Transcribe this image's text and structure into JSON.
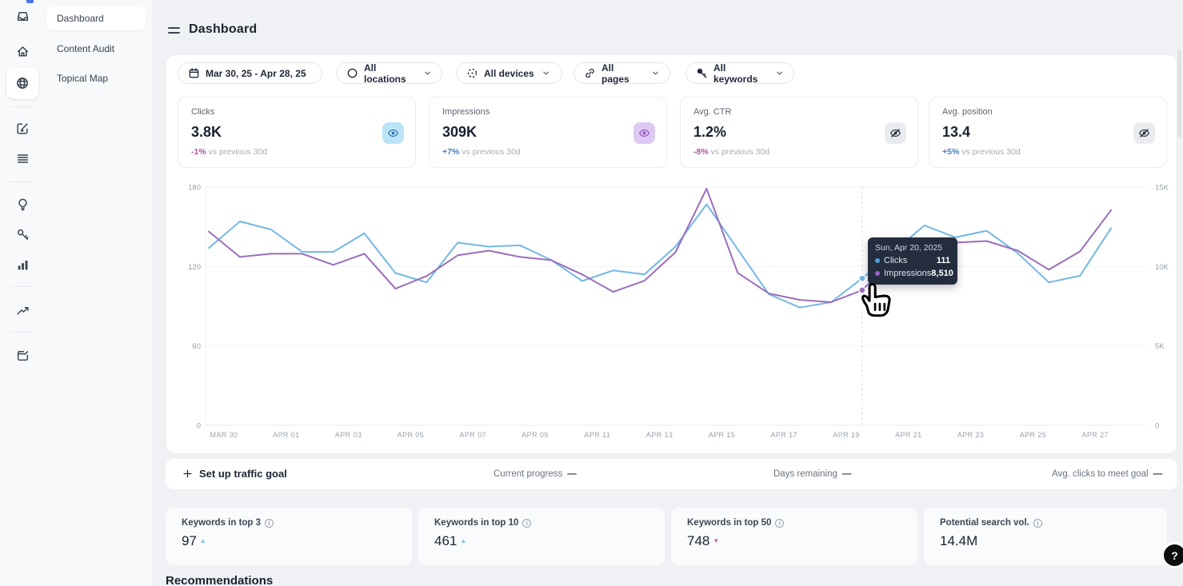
{
  "sidebar": {
    "icons": [
      "inbox-icon",
      "home-icon",
      "globe-icon",
      "compose-icon",
      "list-icon",
      "bulb-icon",
      "key-icon",
      "bar-chart-icon",
      "trend-up-icon",
      "browser-edit-icon"
    ],
    "active_icon": "globe-icon"
  },
  "subnav": {
    "items": [
      {
        "label": "Dashboard",
        "active": true
      },
      {
        "label": "Content Audit",
        "active": false
      },
      {
        "label": "Topical Map",
        "active": false
      }
    ]
  },
  "header": {
    "title": "Dashboard"
  },
  "filters": {
    "date_range": "Mar 30, 25 - Apr 28, 25",
    "dropdowns": [
      {
        "label": "All locations",
        "icon": "globe-contrast-icon"
      },
      {
        "label": "All devices",
        "icon": "devices-icon"
      },
      {
        "label": "All pages",
        "icon": "link-icon"
      },
      {
        "label": "All keywords",
        "icon": "key-icon"
      }
    ]
  },
  "metrics": [
    {
      "label": "Clicks",
      "value": "3.8K",
      "delta": "-1%",
      "delta_dir": "neg",
      "note": "vs previous 30d",
      "badge": "eye-icon",
      "badge_bg": "#bce4f8",
      "badge_fg": "#2d6fa8"
    },
    {
      "label": "Impressions",
      "value": "309K",
      "delta": "+7%",
      "delta_dir": "pos",
      "note": "vs previous 30d",
      "badge": "eye-icon",
      "badge_bg": "#ddc9f4",
      "badge_fg": "#8e4dc2"
    },
    {
      "label": "Avg. CTR",
      "value": "1.2%",
      "delta": "-8%",
      "delta_dir": "neg",
      "note": "vs previous 30d",
      "badge": "eye-off-icon",
      "badge_bg": "#e9ebef",
      "badge_fg": "#252e3c"
    },
    {
      "label": "Avg. position",
      "value": "13.4",
      "delta": "+5%",
      "delta_dir": "pos",
      "note": "vs previous 30d",
      "badge": "eye-off-icon",
      "badge_bg": "#e9ebef",
      "badge_fg": "#252e3c"
    }
  ],
  "chart_data": {
    "type": "line",
    "dates": [
      "Mar 30",
      "Mar 31",
      "Apr 01",
      "Apr 02",
      "Apr 03",
      "Apr 04",
      "Apr 05",
      "Apr 06",
      "Apr 07",
      "Apr 08",
      "Apr 09",
      "Apr 10",
      "Apr 11",
      "Apr 12",
      "Apr 13",
      "Apr 14",
      "Apr 15",
      "Apr 16",
      "Apr 17",
      "Apr 18",
      "Apr 19",
      "Apr 20",
      "Apr 21",
      "Apr 22",
      "Apr 23",
      "Apr 24",
      "Apr 25",
      "Apr 26",
      "Apr 27",
      "Apr 28"
    ],
    "x_tick_labels": [
      "MAR 30",
      "APR 01",
      "APR 03",
      "APR 05",
      "APR 07",
      "APR 09",
      "APR 11",
      "APR 13",
      "APR 15",
      "APR 17",
      "APR 19",
      "APR 21",
      "APR 23",
      "APR 25",
      "APR 27"
    ],
    "series": [
      {
        "name": "Clicks",
        "axis": "left",
        "color": "#73b8e4",
        "values": [
          134,
          154,
          148,
          131,
          131,
          145,
          115,
          108,
          138,
          135,
          136,
          125,
          109,
          117,
          114,
          135,
          167,
          133,
          99,
          89,
          93,
          111,
          131,
          151,
          142,
          147,
          130,
          108,
          113,
          149
        ]
      },
      {
        "name": "Impressions",
        "axis": "right",
        "color": "#9b6dbb",
        "values": [
          12200,
          10600,
          10800,
          10800,
          10100,
          10800,
          8600,
          9400,
          10700,
          11000,
          10600,
          10400,
          9500,
          8400,
          9100,
          10900,
          14900,
          9600,
          8300,
          7900,
          7750,
          8510,
          10400,
          11550,
          11500,
          11600,
          11000,
          9800,
          10950,
          13550
        ]
      }
    ],
    "left_axis": {
      "ticks": [
        180,
        120,
        60,
        0
      ],
      "max": 180,
      "min": 0
    },
    "right_axis": {
      "ticks": [
        "15K",
        "10K",
        "5K",
        "0"
      ],
      "max": 15000,
      "min": 0
    },
    "grid": true,
    "legend": "none",
    "hover_index": 21
  },
  "tooltip": {
    "date": "Sun, Apr 20, 2025",
    "rows": [
      {
        "label": "Clicks",
        "value": "111",
        "color": "#4da3dc"
      },
      {
        "label": "Impressions",
        "value": "8,510",
        "color": "#9c5fd0"
      }
    ]
  },
  "goal_bar": {
    "cta": "Set up traffic goal",
    "items": [
      {
        "label": "Current progress",
        "value": "—"
      },
      {
        "label": "Days remaining",
        "value": "—"
      },
      {
        "label": "Avg. clicks to meet goal",
        "value": "—"
      }
    ]
  },
  "keyword_cards": [
    {
      "label": "Keywords in top 3",
      "value": "97",
      "trend": "up"
    },
    {
      "label": "Keywords in top 10",
      "value": "461",
      "trend": "up"
    },
    {
      "label": "Keywords in top 50",
      "value": "748",
      "trend": "down"
    },
    {
      "label": "Potential search vol.",
      "value": "14.4M",
      "trend": "none"
    }
  ],
  "recommendations": {
    "title": "Recommendations"
  },
  "help": {
    "label": "?"
  },
  "colors": {
    "chart_clicks": "#73b8e4",
    "chart_impressions": "#9b6dbb",
    "positive": "#4a7cba",
    "negative": "#b4519f",
    "tooltip_bg": "#232d3e"
  }
}
